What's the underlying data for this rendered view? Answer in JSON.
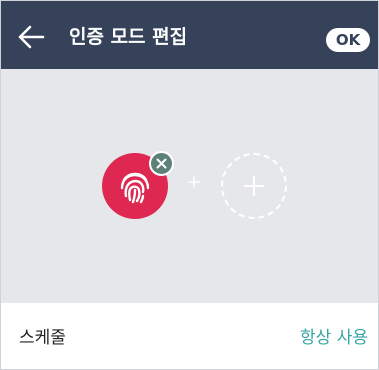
{
  "header": {
    "title": "인증 모드 편집",
    "ok_label": "OK",
    "back_icon": "arrow-left-icon"
  },
  "modes": {
    "selected_icon": "fingerprint-icon",
    "remove_icon": "close-icon",
    "separator_icon": "plus-icon",
    "add_icon": "plus-icon"
  },
  "schedule": {
    "label": "스케줄",
    "value": "항상 사용"
  },
  "colors": {
    "header_bg": "#35425a",
    "panel_bg": "#e6e7ea",
    "fingerprint_bg": "#df2851",
    "remove_badge": "#5d8177",
    "accent": "#3aa5a5"
  }
}
